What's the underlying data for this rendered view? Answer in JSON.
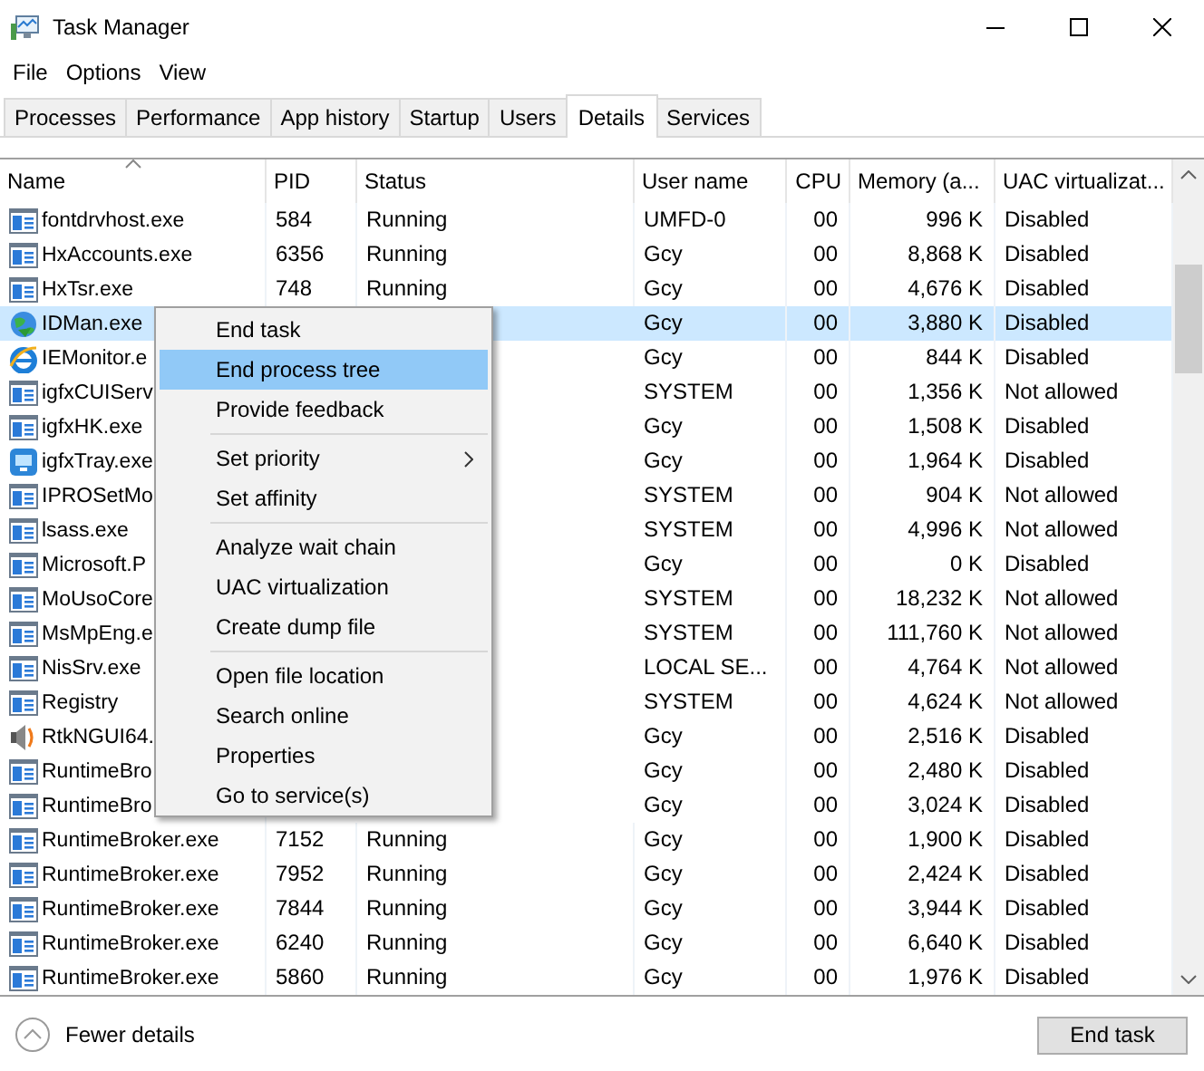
{
  "window": {
    "title": "Task Manager"
  },
  "menu_bar": [
    "File",
    "Options",
    "View"
  ],
  "tabs": [
    {
      "label": "Processes",
      "selected": false
    },
    {
      "label": "Performance",
      "selected": false
    },
    {
      "label": "App history",
      "selected": false
    },
    {
      "label": "Startup",
      "selected": false
    },
    {
      "label": "Users",
      "selected": false
    },
    {
      "label": "Details",
      "selected": true
    },
    {
      "label": "Services",
      "selected": false
    }
  ],
  "table": {
    "columns": [
      {
        "label": "Name",
        "sorted": true
      },
      {
        "label": "PID",
        "sorted": false
      },
      {
        "label": "Status",
        "sorted": false
      },
      {
        "label": "User name",
        "sorted": false
      },
      {
        "label": "CPU",
        "sorted": false
      },
      {
        "label": "Memory (a...",
        "sorted": false
      },
      {
        "label": "UAC virtualizat...",
        "sorted": false
      }
    ],
    "rows": [
      {
        "kind": "app",
        "name": "fontdrvhost.exe",
        "pid": "584",
        "status": "Running",
        "user": "UMFD-0",
        "cpu": "00",
        "memory": "996 K",
        "uac": "Disabled",
        "selected": false
      },
      {
        "kind": "app",
        "name": "HxAccounts.exe",
        "pid": "6356",
        "status": "Running",
        "user": "Gcy",
        "cpu": "00",
        "memory": "8,868 K",
        "uac": "Disabled",
        "selected": false
      },
      {
        "kind": "app",
        "name": "HxTsr.exe",
        "pid": "748",
        "status": "Running",
        "user": "Gcy",
        "cpu": "00",
        "memory": "4,676 K",
        "uac": "Disabled",
        "selected": false
      },
      {
        "kind": "globe",
        "name": "IDMan.exe",
        "user": "Gcy",
        "cpu": "00",
        "memory": "3,880 K",
        "uac": "Disabled",
        "selected": true
      },
      {
        "kind": "browser",
        "name": "IEMonitor.e",
        "user": "Gcy",
        "cpu": "00",
        "memory": "844 K",
        "uac": "Disabled",
        "selected": false
      },
      {
        "kind": "app",
        "name": "igfxCUIServ",
        "user": "SYSTEM",
        "cpu": "00",
        "memory": "1,356 K",
        "uac": "Not allowed",
        "selected": false
      },
      {
        "kind": "app",
        "name": "igfxHK.exe",
        "user": "Gcy",
        "cpu": "00",
        "memory": "1,508 K",
        "uac": "Disabled",
        "selected": false
      },
      {
        "kind": "tray",
        "name": "igfxTray.exe",
        "user": "Gcy",
        "cpu": "00",
        "memory": "1,964 K",
        "uac": "Disabled",
        "selected": false
      },
      {
        "kind": "app",
        "name": "IPROSetMo",
        "user": "SYSTEM",
        "cpu": "00",
        "memory": "904 K",
        "uac": "Not allowed",
        "selected": false
      },
      {
        "kind": "app",
        "name": "lsass.exe",
        "user": "SYSTEM",
        "cpu": "00",
        "memory": "4,996 K",
        "uac": "Not allowed",
        "selected": false
      },
      {
        "kind": "app",
        "name": "Microsoft.P",
        "user": "Gcy",
        "cpu": "00",
        "memory": "0 K",
        "uac": "Disabled",
        "selected": false
      },
      {
        "kind": "app",
        "name": "MoUsoCore",
        "user": "SYSTEM",
        "cpu": "00",
        "memory": "18,232 K",
        "uac": "Not allowed",
        "selected": false
      },
      {
        "kind": "app",
        "name": "MsMpEng.e",
        "user": "SYSTEM",
        "cpu": "00",
        "memory": "111,760 K",
        "uac": "Not allowed",
        "selected": false
      },
      {
        "kind": "app",
        "name": "NisSrv.exe",
        "user": "LOCAL SE...",
        "cpu": "00",
        "memory": "4,764 K",
        "uac": "Not allowed",
        "selected": false
      },
      {
        "kind": "app",
        "name": "Registry",
        "user": "SYSTEM",
        "cpu": "00",
        "memory": "4,624 K",
        "uac": "Not allowed",
        "selected": false
      },
      {
        "kind": "speaker",
        "name": "RtkNGUI64.",
        "user": "Gcy",
        "cpu": "00",
        "memory": "2,516 K",
        "uac": "Disabled",
        "selected": false
      },
      {
        "kind": "app",
        "name": "RuntimeBro",
        "user": "Gcy",
        "cpu": "00",
        "memory": "2,480 K",
        "uac": "Disabled",
        "selected": false
      },
      {
        "kind": "app",
        "name": "RuntimeBro",
        "user": "Gcy",
        "cpu": "00",
        "memory": "3,024 K",
        "uac": "Disabled",
        "selected": false
      },
      {
        "kind": "app",
        "name": "RuntimeBroker.exe",
        "pid": "7152",
        "status": "Running",
        "user": "Gcy",
        "cpu": "00",
        "memory": "1,900 K",
        "uac": "Disabled",
        "selected": false
      },
      {
        "kind": "app",
        "name": "RuntimeBroker.exe",
        "pid": "7952",
        "status": "Running",
        "user": "Gcy",
        "cpu": "00",
        "memory": "2,424 K",
        "uac": "Disabled",
        "selected": false
      },
      {
        "kind": "app",
        "name": "RuntimeBroker.exe",
        "pid": "7844",
        "status": "Running",
        "user": "Gcy",
        "cpu": "00",
        "memory": "3,944 K",
        "uac": "Disabled",
        "selected": false
      },
      {
        "kind": "app",
        "name": "RuntimeBroker.exe",
        "pid": "6240",
        "status": "Running",
        "user": "Gcy",
        "cpu": "00",
        "memory": "6,640 K",
        "uac": "Disabled",
        "selected": false
      },
      {
        "kind": "app",
        "name": "RuntimeBroker.exe",
        "pid": "5860",
        "status": "Running",
        "user": "Gcy",
        "cpu": "00",
        "memory": "1,976 K",
        "uac": "Disabled",
        "selected": false
      }
    ]
  },
  "context_menu": {
    "items": [
      {
        "kind": "item",
        "label": "End task",
        "selected": false,
        "submenu": false
      },
      {
        "kind": "item",
        "label": "End process tree",
        "selected": true,
        "submenu": false
      },
      {
        "kind": "item",
        "label": "Provide feedback",
        "selected": false,
        "submenu": false
      },
      {
        "kind": "separator"
      },
      {
        "kind": "item",
        "label": "Set priority",
        "selected": false,
        "submenu": true
      },
      {
        "kind": "item",
        "label": "Set affinity",
        "selected": false,
        "submenu": false
      },
      {
        "kind": "separator"
      },
      {
        "kind": "item",
        "label": "Analyze wait chain",
        "selected": false,
        "submenu": false
      },
      {
        "kind": "item",
        "label": "UAC virtualization",
        "selected": false,
        "submenu": false
      },
      {
        "kind": "item",
        "label": "Create dump file",
        "selected": false,
        "submenu": false
      },
      {
        "kind": "separator"
      },
      {
        "kind": "item",
        "label": "Open file location",
        "selected": false,
        "submenu": false
      },
      {
        "kind": "item",
        "label": "Search online",
        "selected": false,
        "submenu": false
      },
      {
        "kind": "item",
        "label": "Properties",
        "selected": false,
        "submenu": false
      },
      {
        "kind": "item",
        "label": "Go to service(s)",
        "selected": false,
        "submenu": false
      }
    ]
  },
  "footer": {
    "toggle": "Fewer details",
    "button": "End task"
  }
}
